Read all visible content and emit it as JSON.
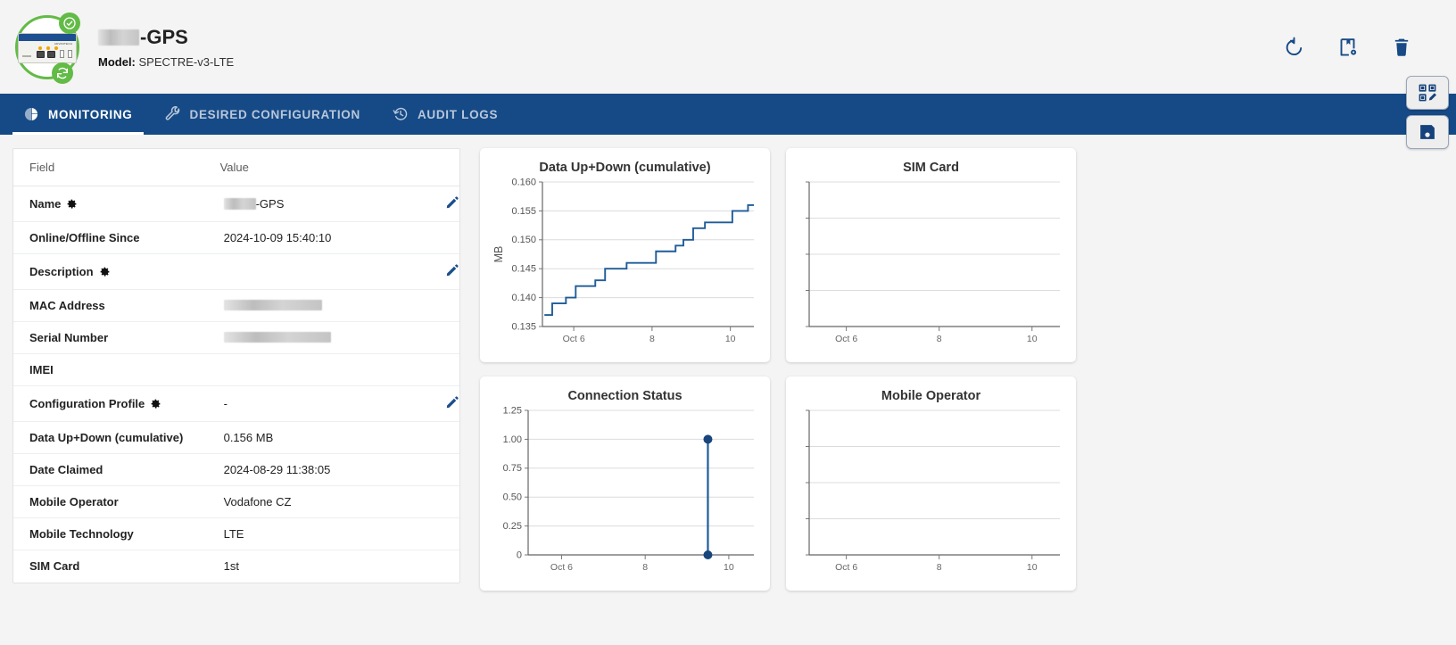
{
  "header": {
    "device_name_suffix": "-GPS",
    "device_name_redacted": true,
    "model_label": "Model:",
    "model_value": "SPECTRE-v3-LTE",
    "status_badges": [
      "check-circle",
      "sync"
    ],
    "actions": [
      {
        "name": "restart-icon",
        "label": "Restart"
      },
      {
        "name": "device-config-icon",
        "label": "Device Configuration"
      },
      {
        "name": "delete-icon",
        "label": "Delete"
      }
    ]
  },
  "float_buttons": [
    {
      "name": "qr-edit-button",
      "label": "Edit QR"
    },
    {
      "name": "save-button",
      "label": "Save"
    }
  ],
  "nav": {
    "tabs": [
      {
        "label": "MONITORING",
        "icon": "pie-chart-icon",
        "active": true
      },
      {
        "label": "DESIRED CONFIGURATION",
        "icon": "wrench-icon",
        "active": false
      },
      {
        "label": "AUDIT LOGS",
        "icon": "history-icon",
        "active": false
      }
    ]
  },
  "info_table": {
    "columns": [
      "Field",
      "Value"
    ],
    "rows": [
      {
        "field": "Name",
        "gear": true,
        "value": "-GPS",
        "redact": "name",
        "edit": true
      },
      {
        "field": "Online/Offline Since",
        "gear": false,
        "value": "2024-10-09 15:40:10",
        "redact": null,
        "edit": false
      },
      {
        "field": "Description",
        "gear": true,
        "value": "",
        "redact": null,
        "edit": true
      },
      {
        "field": "MAC Address",
        "gear": false,
        "value": "",
        "redact": "mac",
        "edit": false
      },
      {
        "field": "Serial Number",
        "gear": false,
        "value": "",
        "redact": "serial",
        "edit": false
      },
      {
        "field": "IMEI",
        "gear": false,
        "value": "",
        "redact": null,
        "edit": false
      },
      {
        "field": "Configuration Profile",
        "gear": true,
        "value": "-",
        "redact": null,
        "edit": true
      },
      {
        "field": "Data Up+Down (cumulative)",
        "gear": false,
        "value": "0.156 MB",
        "redact": null,
        "edit": false
      },
      {
        "field": "Date Claimed",
        "gear": false,
        "value": "2024-08-29 11:38:05",
        "redact": null,
        "edit": false
      },
      {
        "field": "Mobile Operator",
        "gear": false,
        "value": "Vodafone CZ",
        "redact": null,
        "edit": false
      },
      {
        "field": "Mobile Technology",
        "gear": false,
        "value": "LTE",
        "redact": null,
        "edit": false
      },
      {
        "field": "SIM Card",
        "gear": false,
        "value": "1st",
        "redact": null,
        "edit": false
      }
    ]
  },
  "chart_data": [
    {
      "id": "data-up-down",
      "type": "line",
      "title": "Data Up+Down (cumulative)",
      "xlabel": "",
      "ylabel": "MB",
      "ylim": [
        0.135,
        0.16
      ],
      "yticks": [
        0.135,
        0.14,
        0.145,
        0.15,
        0.155,
        0.16
      ],
      "ytick_labels": [
        "0.135",
        "0.140",
        "0.145",
        "0.150",
        "0.155",
        "0.160"
      ],
      "xlim": [
        5.2,
        10.6
      ],
      "xticks": [
        6,
        8,
        10
      ],
      "xtick_labels": [
        "Oct 6",
        "8",
        "10"
      ],
      "grid": true,
      "legend": "none",
      "line_color": "#1f5c99",
      "step": true,
      "x": [
        5.25,
        5.45,
        5.6,
        5.8,
        6.05,
        6.3,
        6.55,
        6.8,
        7.05,
        7.35,
        7.7,
        8.1,
        8.4,
        8.6,
        8.8,
        9.05,
        9.35,
        9.7,
        10.05,
        10.45
      ],
      "values": [
        0.137,
        0.139,
        0.139,
        0.14,
        0.142,
        0.142,
        0.143,
        0.145,
        0.145,
        0.146,
        0.146,
        0.148,
        0.148,
        0.149,
        0.15,
        0.152,
        0.153,
        0.153,
        0.155,
        0.156
      ]
    },
    {
      "id": "sim-card",
      "type": "line",
      "title": "SIM Card",
      "xlabel": "",
      "ylabel": "",
      "ylim": [
        0,
        1
      ],
      "yticks": [
        0,
        0.25,
        0.5,
        0.75,
        1
      ],
      "ytick_labels": [
        "",
        "",
        "",
        "",
        ""
      ],
      "xlim": [
        5.2,
        10.6
      ],
      "xticks": [
        6,
        8,
        10
      ],
      "xtick_labels": [
        "Oct 6",
        "8",
        "10"
      ],
      "grid": true,
      "legend": "none",
      "x": [],
      "values": []
    },
    {
      "id": "connection-status",
      "type": "scatter",
      "title": "Connection Status",
      "xlabel": "",
      "ylabel": "",
      "ylim": [
        0,
        1.25
      ],
      "yticks": [
        0,
        0.25,
        0.5,
        0.75,
        1.0,
        1.25
      ],
      "ytick_labels": [
        "0",
        "0.25",
        "0.50",
        "0.75",
        "1.00",
        "1.25"
      ],
      "xlim": [
        5.2,
        10.6
      ],
      "xticks": [
        6,
        8,
        10
      ],
      "xtick_labels": [
        "Oct 6",
        "8",
        "10"
      ],
      "grid": true,
      "legend": "none",
      "line_color": "#1f5c99",
      "marker_color": "#17457c",
      "x": [
        9.5,
        9.5
      ],
      "values": [
        0,
        1
      ]
    },
    {
      "id": "mobile-operator",
      "type": "line",
      "title": "Mobile Operator",
      "xlabel": "",
      "ylabel": "",
      "ylim": [
        0,
        1
      ],
      "yticks": [
        0,
        0.25,
        0.5,
        0.75,
        1
      ],
      "ytick_labels": [
        "",
        "",
        "",
        "",
        ""
      ],
      "xlim": [
        5.2,
        10.6
      ],
      "xticks": [
        6,
        8,
        10
      ],
      "xtick_labels": [
        "Oct 6",
        "8",
        "10"
      ],
      "grid": true,
      "legend": "none",
      "x": [],
      "values": []
    }
  ],
  "colors": {
    "nav_bg": "#164a86",
    "accent": "#1a4f8a",
    "status_green": "#62bb46",
    "page_bg": "#f4f4f4"
  }
}
